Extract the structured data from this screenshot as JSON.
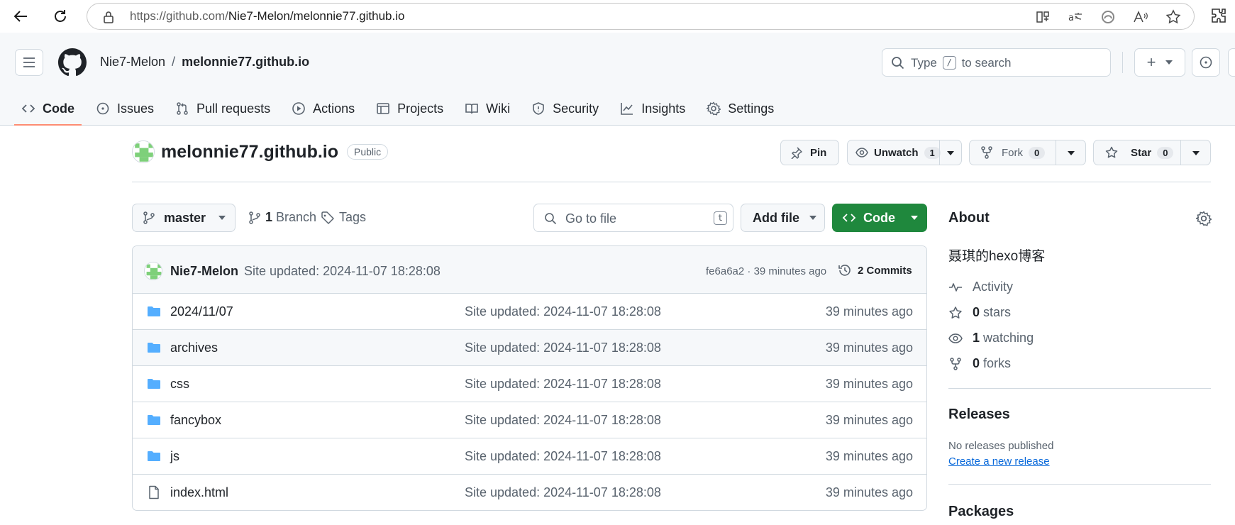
{
  "browser": {
    "url_prefix": "https://github.com/",
    "url_path": "Nie7-Melon/melonnie77.github.io"
  },
  "header": {
    "owner": "Nie7-Melon",
    "separator": "/",
    "repo": "melonnie77.github.io",
    "search_before": "Type",
    "search_key": "/",
    "search_after": "to search",
    "plus_label": "+"
  },
  "nav": {
    "tabs": [
      {
        "label": "Code",
        "icon": "code-icon"
      },
      {
        "label": "Issues",
        "icon": "issue-icon"
      },
      {
        "label": "Pull requests",
        "icon": "pull-request-icon"
      },
      {
        "label": "Actions",
        "icon": "play-icon"
      },
      {
        "label": "Projects",
        "icon": "table-icon"
      },
      {
        "label": "Wiki",
        "icon": "book-icon"
      },
      {
        "label": "Security",
        "icon": "shield-icon"
      },
      {
        "label": "Insights",
        "icon": "graph-icon"
      },
      {
        "label": "Settings",
        "icon": "gear-icon"
      }
    ]
  },
  "repo": {
    "name": "melonnie77.github.io",
    "visibility": "Public",
    "pin_label": "Pin",
    "unwatch_label": "Unwatch",
    "watch_count": "1",
    "fork_label": "Fork",
    "fork_count": "0",
    "star_label": "Star",
    "star_count": "0"
  },
  "toolbar": {
    "branch": "master",
    "branch_count": "1",
    "branch_label": "Branch",
    "tags_label": "Tags",
    "goto_placeholder": "Go to file",
    "goto_key": "t",
    "add_file_label": "Add file",
    "code_label": "Code"
  },
  "commit": {
    "author": "Nie7-Melon",
    "message": "Site updated: 2024-11-07 18:28:08",
    "hash": "fe6a6a2",
    "meta_sep": "·",
    "time": "39 minutes ago",
    "commits_count": "2",
    "commits_label": "Commits"
  },
  "files": [
    {
      "name": "2024/11/07",
      "type": "folder",
      "message": "Site updated: 2024-11-07 18:28:08",
      "time": "39 minutes ago"
    },
    {
      "name": "archives",
      "type": "folder",
      "message": "Site updated: 2024-11-07 18:28:08",
      "time": "39 minutes ago"
    },
    {
      "name": "css",
      "type": "folder",
      "message": "Site updated: 2024-11-07 18:28:08",
      "time": "39 minutes ago"
    },
    {
      "name": "fancybox",
      "type": "folder",
      "message": "Site updated: 2024-11-07 18:28:08",
      "time": "39 minutes ago"
    },
    {
      "name": "js",
      "type": "folder",
      "message": "Site updated: 2024-11-07 18:28:08",
      "time": "39 minutes ago"
    },
    {
      "name": "index.html",
      "type": "file",
      "message": "Site updated: 2024-11-07 18:28:08",
      "time": "39 minutes ago"
    }
  ],
  "about": {
    "title": "About",
    "description": "聂琪的hexo博客",
    "activity_label": "Activity",
    "stars_count": "0",
    "stars_label": "stars",
    "watching_count": "1",
    "watching_label": "watching",
    "forks_count": "0",
    "forks_label": "forks",
    "releases_title": "Releases",
    "no_releases": "No releases published",
    "create_release": "Create a new release",
    "packages_title": "Packages"
  },
  "colors": {
    "accent_green": "#1f883d",
    "link_blue": "#0969da",
    "folder_blue": "#54aeff",
    "active_tab_underline": "#fd8c73"
  }
}
